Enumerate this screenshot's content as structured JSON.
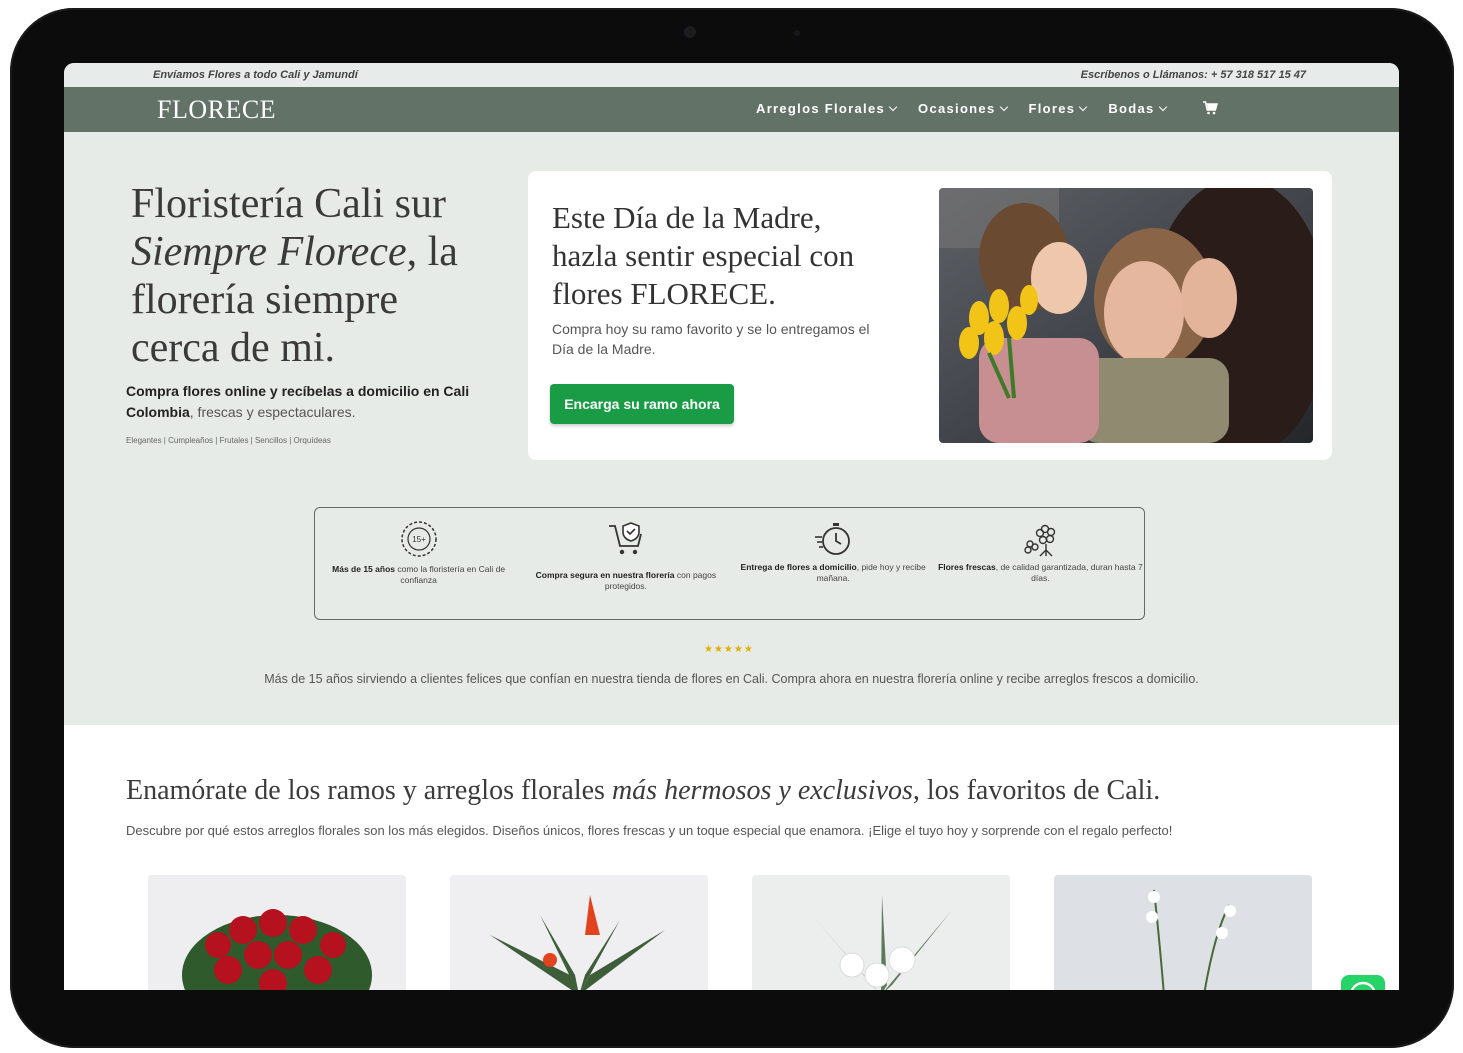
{
  "topbar": {
    "left": "Envíamos Flores a todo Cali y Jamundí",
    "right": "Escríbenos o Llámanos: + 57 318 517 15 47"
  },
  "nav": {
    "logo": "FLORECE",
    "items": [
      "Arreglos Florales",
      "Ocasiones",
      "Flores",
      "Bodas"
    ],
    "cart_icon": "cart-icon"
  },
  "hero": {
    "title_line1": "Floristería Cali sur",
    "title_em": "Siempre Florece",
    "title_rest": ", la florería siempre cerca de mi.",
    "sub_bold": "Compra flores online y recíbelas a domicilio en Cali Colombia",
    "sub_rest": ", frescas y espectaculares.",
    "tags": "Elegantes | Cumpleaños | Frutales | Sencillos | Orquídeas"
  },
  "promo": {
    "title": "Este Día de la Madre, hazla sentir especial con flores FLORECE.",
    "text": "Compra hoy su ramo favorito y se lo entregamos el Día de la Madre.",
    "button": "Encarga su ramo ahora"
  },
  "features": [
    {
      "icon": "badge-15-years-icon",
      "bold": "Más de 15 años",
      "text": " como la floristería en Cali de confianza"
    },
    {
      "icon": "secure-cart-icon",
      "bold": "Compra segura en nuestra florería",
      "text": " con pagos protegidos."
    },
    {
      "icon": "stopwatch-delivery-icon",
      "bold": "Entrega de flores a domicilio",
      "text": ", pide hoy y recibe mañana."
    },
    {
      "icon": "flowers-icon",
      "bold": "Flores frescas",
      "text": ", de calidad garantizada, duran hasta 7 días."
    }
  ],
  "stars": "★★★★★",
  "trust_text": "Más de 15 años sirviendo a clientes felices que confían en nuestra tienda de flores en Cali. Compra ahora en nuestra florería online y recibe arreglos frescos a domicilio.",
  "section2": {
    "title_a": "Enamórate de los ramos y arreglos florales ",
    "title_em": "más hermosos y exclusivos",
    "title_b": ", los favoritos de Cali.",
    "text": "Descubre por qué estos arreglos florales son los más elegidos. Diseños únicos, flores frescas y un toque especial que enamora. ¡Elige el tuyo hoy y sorprende con el regalo perfecto!"
  },
  "colors": {
    "nav_bg": "#627267",
    "hero_bg": "#e6ebe8",
    "cta": "#1a9c46",
    "stars": "#e2b100"
  }
}
